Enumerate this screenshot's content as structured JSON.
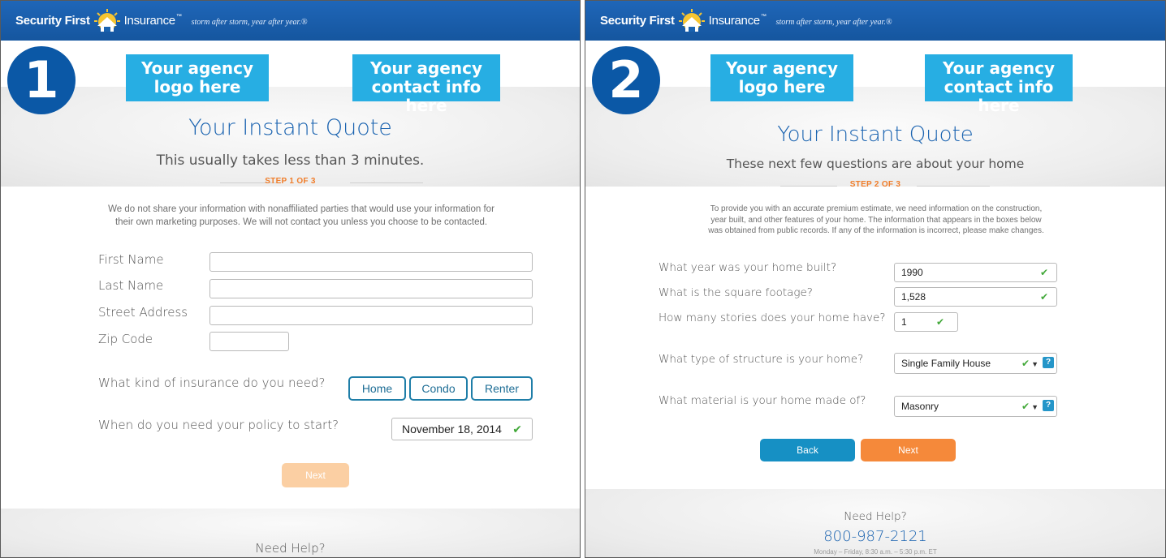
{
  "brand": {
    "left": "Security First",
    "right": "Insurance",
    "trademark": "™",
    "slogan": "storm after storm, year after year.®"
  },
  "panel1": {
    "step_number": "1",
    "agency_logo": [
      "Your agency",
      "logo here"
    ],
    "agency_contact": [
      "Your agency",
      "contact info here"
    ],
    "title": "Your Instant Quote",
    "subtitle": "This usually takes less than 3 minutes.",
    "step_label": "STEP 1 OF 3",
    "privacy": [
      "We do not share your information with nonaffiliated parties that would use your information for",
      "their own marketing purposes. We will not contact you unless you choose to be contacted."
    ],
    "fields": {
      "first_name": "First Name",
      "last_name": "Last Name",
      "street": "Street Address",
      "zip": "Zip Code"
    },
    "insurance_question": "What kind of insurance do you need?",
    "insurance_options": [
      "Home",
      "Condo",
      "Renter"
    ],
    "start_question": "When do you need your policy to start?",
    "start_date": "November 18, 2014",
    "next_label": "Next",
    "help_title": "Need Help?"
  },
  "panel2": {
    "step_number": "2",
    "agency_logo": [
      "Your agency",
      "logo here"
    ],
    "agency_contact": [
      "Your agency",
      "contact info here"
    ],
    "title": "Your Instant Quote",
    "subtitle": "These next few questions are about your home",
    "step_label": "STEP 2 OF 3",
    "intro": [
      "To provide you with an accurate premium estimate, we need information on the construction,",
      "year built, and other features of your home. The information that appears in the boxes below",
      "was obtained from public records. If any of the information is incorrect, please make changes."
    ],
    "questions": {
      "year_q": "What year was your home built?",
      "year_v": "1990",
      "sqft_q": "What is the square footage?",
      "sqft_v": "1,528",
      "stories_q": "How many stories does your home have?",
      "stories_v": "1",
      "structure_q": "What type of structure is your home?",
      "structure_v": "Single Family House",
      "material_q": "What material is your home made of?",
      "material_v": "Masonry"
    },
    "back_label": "Back",
    "next_label": "Next",
    "help_title": "Need Help?",
    "phone": "800-987-2121",
    "hours": "Monday – Friday, 8:30 a.m. – 5:30 p.m. ET"
  },
  "colors": {
    "brand_blue": "#1a63b0",
    "placeholder_cyan": "#27aee3",
    "step_orange": "#f07d2a",
    "next_orange": "#f5893a",
    "next_disabled": "#fbcfa3",
    "back_blue": "#1690c4",
    "check_green": "#41a838"
  },
  "icons": {
    "brand_logo": "house-sun-icon",
    "check": "check-icon",
    "caret": "caret-down-icon",
    "help": "help-icon"
  }
}
